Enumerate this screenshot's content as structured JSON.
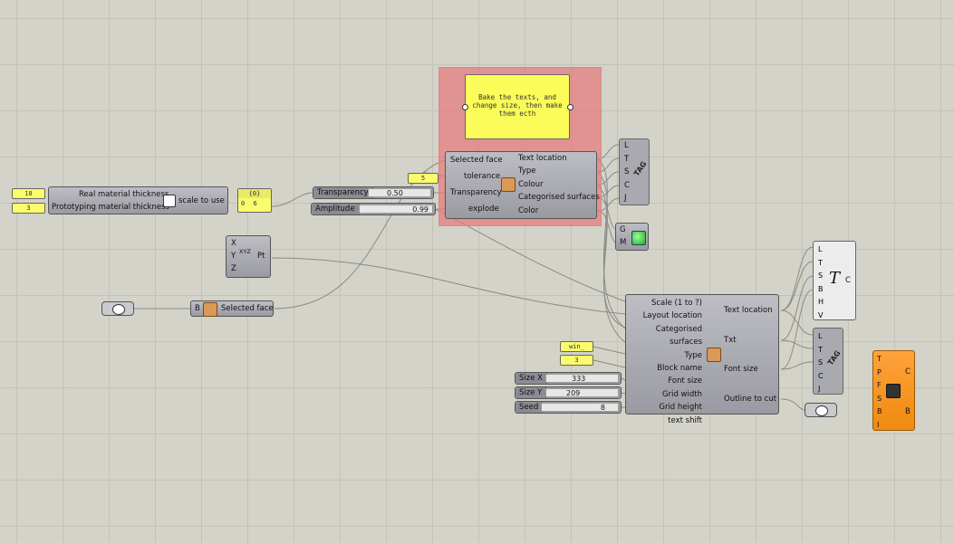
{
  "note_panel": {
    "text": "Bake the texts, and change size, then make them ecth"
  },
  "thickness_comp": {
    "inputs": [
      "Real material thickness",
      "Prototyping material thickness"
    ],
    "output": "scale to use",
    "real_value": "18",
    "proto_value": "3",
    "result_panel": "{0}",
    "result_index": "0",
    "result_value": "6"
  },
  "sliders": {
    "transparency": {
      "name": "Transparency",
      "value": "0.50"
    },
    "amplitude": {
      "name": "Amplitude",
      "value": "0.99"
    },
    "size_x": {
      "name": "Size X",
      "value": "333"
    },
    "size_y": {
      "name": "Size Y",
      "value": "209"
    },
    "seed": {
      "name": "Seed",
      "value": "8"
    }
  },
  "tolerance_value": "5",
  "bake_comp": {
    "inputs": [
      "Selected face",
      "tolerance",
      "Transparency",
      "explode"
    ],
    "outputs": [
      "Text location",
      "Type",
      "Colour",
      "Categorised surfaces",
      "Color"
    ]
  },
  "tag_top": {
    "ports": [
      "L",
      "T",
      "S",
      "C",
      "J"
    ],
    "label": "TAG"
  },
  "preview": {
    "ports": [
      "G",
      "M"
    ]
  },
  "pt_comp": {
    "inputs": [
      "X",
      "Y",
      "Z"
    ],
    "output": "Pt",
    "icon_label": "XYZ"
  },
  "face_comp": {
    "input": "B",
    "output": "Selected face"
  },
  "layout_comp": {
    "inputs": [
      "Scale (1 to ?)",
      "Layout location",
      "Categorised surfaces",
      "Type",
      "Block name",
      "Font size",
      "Grid width",
      "Grid height",
      "text shift"
    ],
    "outputs": [
      "Text location",
      "Txt",
      "Font size",
      "Outline to cut"
    ]
  },
  "block_name_value": "win_",
  "font_size_value": "3",
  "text_comp": {
    "ports": [
      "L",
      "T",
      "S",
      "B",
      "H",
      "V"
    ],
    "output": "C",
    "symbol": "T"
  },
  "tag_bottom": {
    "ports": [
      "L",
      "T",
      "S",
      "C",
      "J"
    ],
    "label": "TAG"
  },
  "export_comp": {
    "inputs": [
      "T",
      "P",
      "F",
      "S",
      "B",
      "I"
    ],
    "outputs": [
      "C",
      "B"
    ]
  },
  "colors": {
    "group": "#e88080",
    "panel": "#fbfb6e",
    "orange": "#f7941d",
    "canvas": "#d4d3c9"
  }
}
